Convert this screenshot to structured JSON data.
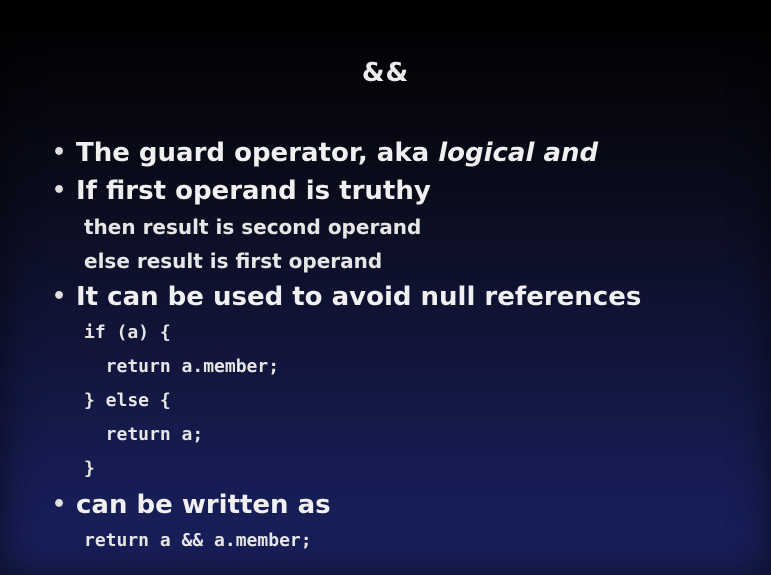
{
  "slide": {
    "title": "&&",
    "bullets": [
      {
        "text_before": "The guard operator, aka ",
        "text_italic": "logical and"
      },
      {
        "text": "If first operand is truthy",
        "sub_lines": [
          "then result is second operand",
          "else result is first operand"
        ]
      },
      {
        "text": "It can be used to avoid null references",
        "code_lines": [
          "if (a) {",
          "  return a.member;",
          "} else {",
          "  return a;",
          "}"
        ]
      },
      {
        "text": "can be written as",
        "code_lines": [
          "return a && a.member;"
        ]
      }
    ],
    "bullet_glyph": "•"
  }
}
